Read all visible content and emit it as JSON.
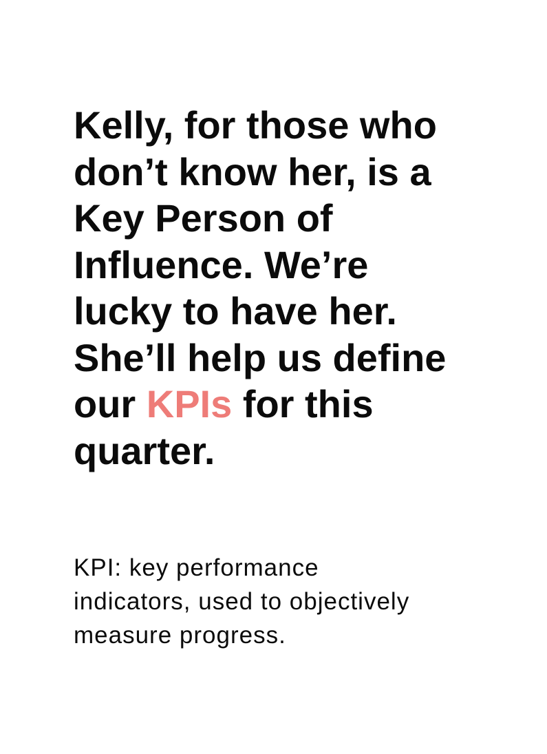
{
  "quote": {
    "lines": [
      "Kelly, for those who",
      "don’t know her, is a",
      "Key Person of",
      "Influence. We’re",
      "lucky to have her.",
      "She’ll help us define"
    ],
    "line7_before": "our ",
    "line7_highlight": "KPIs",
    "line7_after": " for this",
    "line8": "quarter.",
    "highlight_color": "#ee7c78"
  },
  "note": {
    "lines": [
      "KPI: key performance",
      "indicators, used to objectively",
      "measure progress."
    ]
  }
}
